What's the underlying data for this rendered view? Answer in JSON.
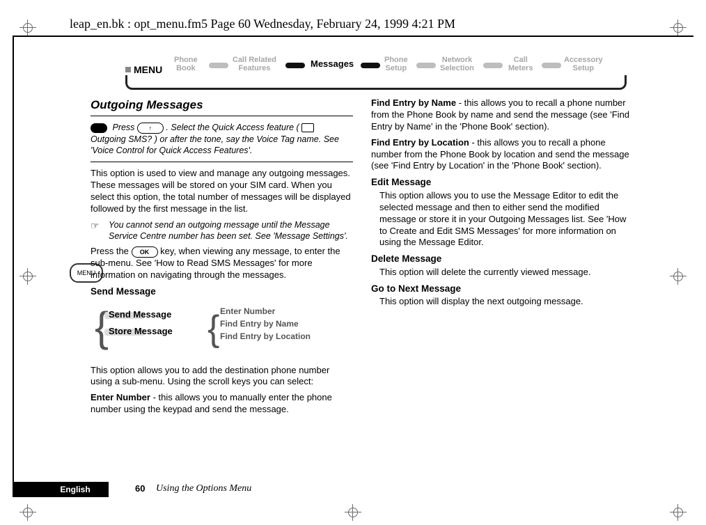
{
  "header_line": "leap_en.bk : opt_menu.fm5  Page 60  Wednesday, February 24, 1999  4:21 PM",
  "menu_key_label": "MENU",
  "menubar": {
    "label": "MENU",
    "items": [
      {
        "label": "Phone\nBook"
      },
      {
        "label": "Call Related\nFeatures"
      },
      {
        "label": "Messages",
        "active": true
      },
      {
        "label": "Phone\nSetup"
      },
      {
        "label": "Network\nSelection"
      },
      {
        "label": "Call\nMeters"
      },
      {
        "label": "Accessory\nSetup"
      }
    ]
  },
  "left": {
    "title": "Outgoing Messages",
    "qa_before": "Press ",
    "qa_key_hint": "↑",
    "qa_mid": ". Select the Quick Access feature (",
    "qa_feature": " Outgoing SMS?",
    "qa_after": ") or after the tone, say the Voice Tag name. See 'Voice Control for Quick Access Features'.",
    "intro": "This option is used to view and manage any outgoing messages. These messages will be stored on your SIM card. When you select this option, the total number of messages will be displayed followed by the first message in the list.",
    "note": "You cannot send an outgoing message until the Message Service Centre number has been set. See 'Message Settings'.",
    "press_a": "Press the ",
    "press_key": "OK",
    "press_b": " key, when viewing any message, to enter the sub-menu. See 'How to Read SMS Messages' for more information on navigating through the messages.",
    "send_heading": "Send Message",
    "diagram": {
      "send": "Send Message",
      "store": "Store Message",
      "enter": "Enter Number",
      "find_name": "Find Entry by Name",
      "find_loc": "Find Entry by Location"
    },
    "send_desc": "This option allows you to add the destination phone number using a sub-menu. Using the scroll keys you can select:",
    "enter_number_label": "Enter Number",
    "enter_number_text": " - this allows you to manually enter the phone number using the keypad and send the message."
  },
  "right": {
    "find_name_label": "Find Entry by Name",
    "find_name_text": " - this allows you to recall a phone number from the Phone Book by name and send the message (see 'Find Entry by Name' in the 'Phone Book' section).",
    "find_loc_label": "Find Entry by Location",
    "find_loc_text": " - this allows you to recall a phone number from the Phone Book by location and send the message (see 'Find Entry by Location' in the 'Phone Book' section).",
    "edit_heading": "Edit Message",
    "edit_text": "This option allows you to use the Message Editor to edit the selected message and then to either send the modified message or store it in your Outgoing Messages list. See 'How to Create and Edit SMS Messages' for more information on using the Message Editor.",
    "delete_heading": "Delete Message",
    "delete_text": "This option will delete the currently viewed message.",
    "next_heading": "Go to Next Message",
    "next_text": "This option will display the next outgoing message."
  },
  "footer": {
    "language": "English",
    "page": "60",
    "chapter": "Using the Options Menu"
  }
}
